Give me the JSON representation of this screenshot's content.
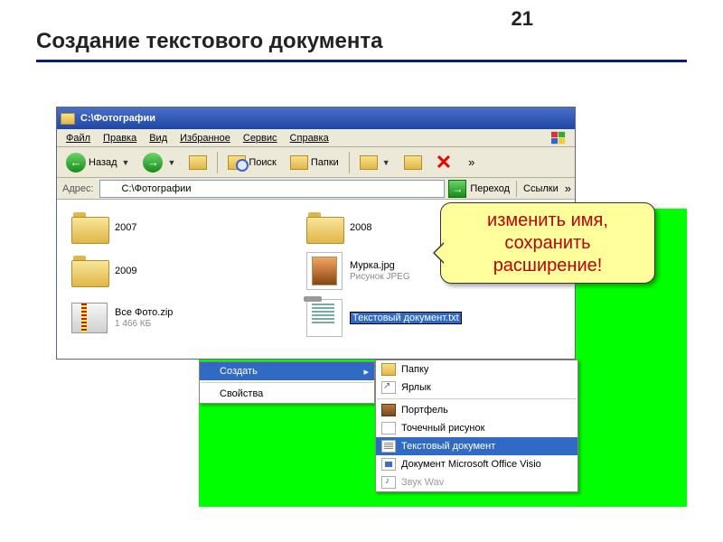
{
  "page_number": "21",
  "slide_title": "Создание текстового документа",
  "explorer": {
    "title": "С:\\Фотографии",
    "menus": {
      "file": "Файл",
      "edit": "Правка",
      "view": "Вид",
      "favorites": "Избранное",
      "tools": "Сервис",
      "help": "Справка"
    },
    "toolbar": {
      "back": "Назад",
      "search": "Поиск",
      "folders": "Папки",
      "more": "»"
    },
    "address": {
      "label": "Адрес:",
      "value": "С:\\Фотографии",
      "go": "Переход",
      "links": "Ссылки"
    },
    "files": {
      "f2007": "2007",
      "f2008": "2008",
      "f2009": "2009",
      "zip_name": "Все Фото.zip",
      "zip_size": "1 466 КБ",
      "jpg_name": "Мурка.jpg",
      "jpg_desc": "Рисунок JPEG",
      "newtxt": "Текстовый документ.txt"
    }
  },
  "ctx_left": {
    "create": "Создать",
    "properties": "Свойства"
  },
  "ctx_right": {
    "folder": "Папку",
    "shortcut": "Ярлык",
    "briefcase": "Портфель",
    "bmp": "Точечный рисунок",
    "txt": "Текстовый документ",
    "visio": "Документ Microsoft Office Visio",
    "wav": "Звук Wav"
  },
  "callout_line1": "изменить имя,",
  "callout_line2": "сохранить",
  "callout_line3": "расширение!"
}
